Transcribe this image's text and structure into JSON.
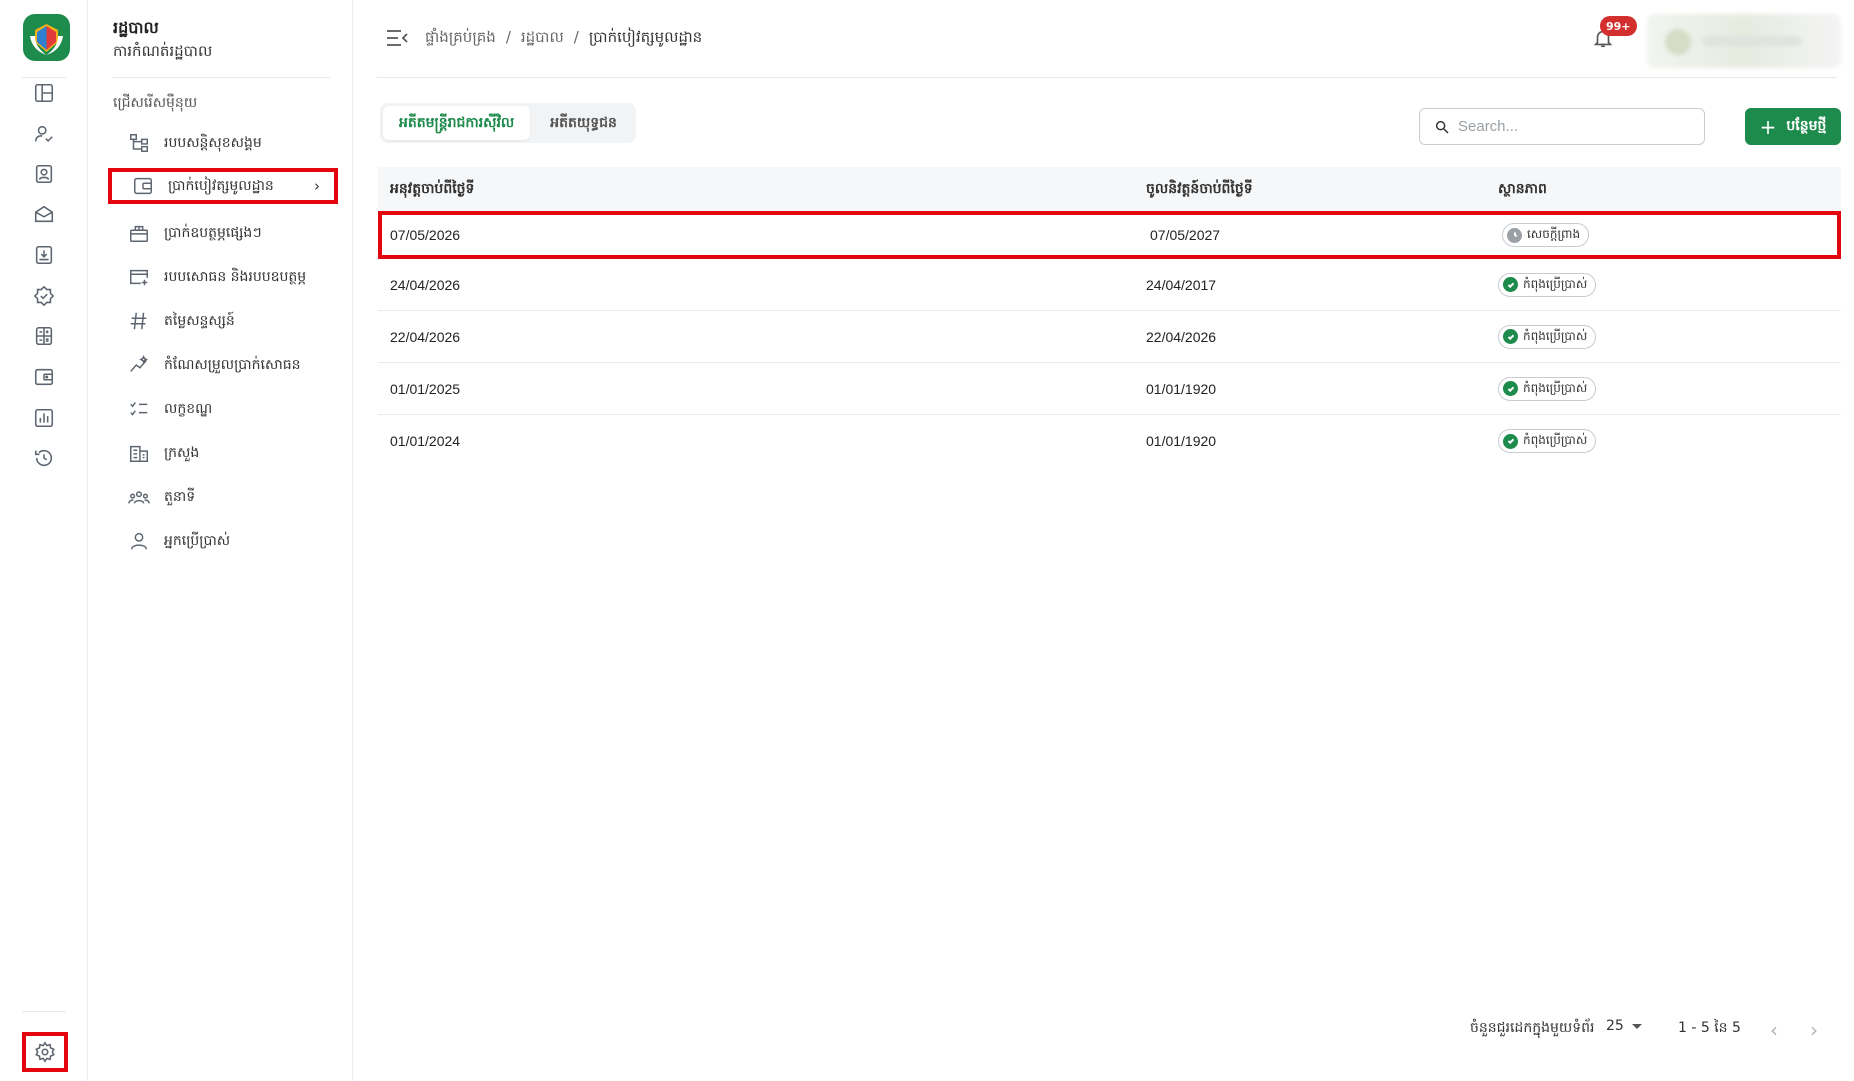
{
  "sidebar_menu": {
    "title": "រដ្ឋបាល",
    "subtitle": "ការកំណត់រដ្ឋបាល",
    "section_label": "ជ្រើសរើសម៉ឺនុយ",
    "items": [
      {
        "label": "របបសន្តិសុខសង្គម",
        "icon": "hierarchy-icon"
      },
      {
        "label": "ប្រាក់បៀវត្សមូលដ្ឋាន",
        "icon": "wallet-icon"
      },
      {
        "label": "ប្រាក់ឧបត្ថម្ភផ្សេងៗ",
        "icon": "gift-icon"
      },
      {
        "label": "របបសោធន និងរបបឧបត្ថម្ភ",
        "icon": "card-plus-icon"
      },
      {
        "label": "តម្លៃសន្ទស្សន៍",
        "icon": "hashtag-icon"
      },
      {
        "label": "កំណែសម្រួលប្រាក់សោធន",
        "icon": "sparkle-chart-icon"
      },
      {
        "label": "លក្ខខណ្ឌ",
        "icon": "checklist-icon"
      },
      {
        "label": "ក្រសួង",
        "icon": "building-icon"
      },
      {
        "label": "តួនាទី",
        "icon": "people-group-icon"
      },
      {
        "label": "អ្នកប្រើប្រាស់",
        "icon": "user-icon"
      }
    ]
  },
  "header": {
    "breadcrumb": [
      "ផ្ទាំងគ្រប់គ្រង",
      "រដ្ឋបាល",
      "ប្រាក់បៀវត្សមូលដ្ឋាន"
    ],
    "separator": "/",
    "notification_badge": "99+"
  },
  "tabs": [
    {
      "label": "អតីតមន្ត្រីរាជការស៊ីវិល",
      "active": true
    },
    {
      "label": "អតីតយុទ្ធជន",
      "active": false
    }
  ],
  "toolbar": {
    "search_placeholder": "Search...",
    "add_plus": "+",
    "add_label": "បន្ថែមថ្មី"
  },
  "table": {
    "columns": [
      "អនុវត្តចាប់ពីថ្ងៃទី",
      "ចូលនិវត្តន៍ចាប់ពីថ្ងៃទី",
      "ស្ថានភាព"
    ],
    "rows": [
      {
        "effective": "07/05/2026",
        "retire": "07/05/2027",
        "status": "សេចក្តីព្រាង",
        "status_type": "draft"
      },
      {
        "effective": "24/04/2026",
        "retire": "24/04/2017",
        "status": "កំពុងប្រើប្រាស់",
        "status_type": "active"
      },
      {
        "effective": "22/04/2026",
        "retire": "22/04/2026",
        "status": "កំពុងប្រើប្រាស់",
        "status_type": "active"
      },
      {
        "effective": "01/01/2025",
        "retire": "01/01/1920",
        "status": "កំពុងប្រើប្រាស់",
        "status_type": "active"
      },
      {
        "effective": "01/01/2024",
        "retire": "01/01/1920",
        "status": "កំពុងប្រើប្រាស់",
        "status_type": "active"
      }
    ]
  },
  "pagination": {
    "rows_per_page_label": "ចំនួនជួរដេកក្នុងមួយទំព័រ",
    "rows_per_page": "25",
    "range": "1 - 5 នៃ 5",
    "prev": "‹",
    "next": "›"
  },
  "colors": {
    "brand_green": "#1d8b4c",
    "highlight_red": "#e3060f",
    "badge_red": "#d32f2f"
  }
}
